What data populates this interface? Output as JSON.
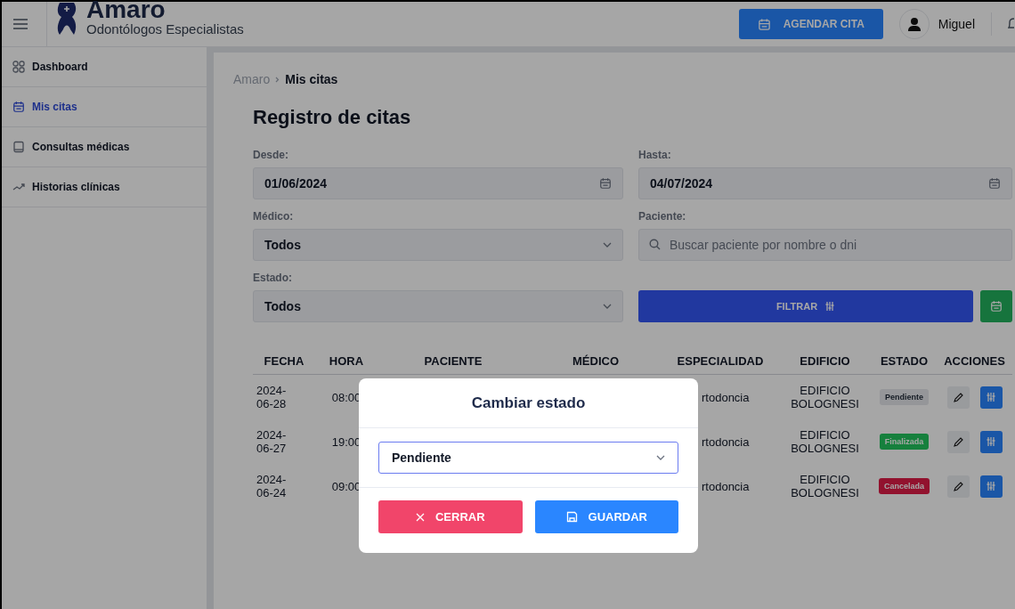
{
  "header": {
    "brand": "Amaro",
    "tagline": "Odontólogos Especialistas",
    "action_button": "AGENDAR CITA",
    "user": "Miguel"
  },
  "sidebar": {
    "items": [
      {
        "label": "Dashboard",
        "selected": false
      },
      {
        "label": "Mis citas",
        "selected": true
      },
      {
        "label": "Consultas médicas",
        "selected": false
      },
      {
        "label": "Historias clínicas",
        "selected": false
      }
    ]
  },
  "breadcrumb": [
    "Amaro",
    "Mis citas"
  ],
  "title": "Registro de citas",
  "filters": [
    {
      "kind": "date",
      "label": "Desde:",
      "value": "01/06/2024"
    },
    {
      "kind": "date",
      "label": "Hasta:",
      "value": "04/07/2024"
    },
    {
      "kind": "select",
      "label": "Médico:",
      "value": "Todos"
    },
    {
      "kind": "search",
      "label": "Paciente:",
      "placeholder": "Buscar paciente por nombre o dni"
    },
    {
      "kind": "select",
      "label": "Estado:",
      "value": "Todos"
    }
  ],
  "filter_button": "FILTRAR",
  "table": {
    "columns": [
      "FECHA",
      "HORA",
      "PACIENTE",
      "MÉDICO",
      "ESPECIALIDAD",
      "EDIFICIO",
      "ESTADO",
      "ACCIONES"
    ],
    "rows": [
      {
        "fecha": "2024-06-28",
        "hora": "08:00",
        "especialidad": "rtodoncia",
        "edificio": "EDIFICIO BOLOGNESI",
        "estado": "Pendiente",
        "kind": "pending"
      },
      {
        "fecha": "2024-06-27",
        "hora": "19:00",
        "especialidad": "rtodoncia",
        "edificio": "EDIFICIO BOLOGNESI",
        "estado": "Finalizada",
        "kind": "done"
      },
      {
        "fecha": "2024-06-24",
        "hora": "09:00",
        "especialidad": "rtodoncia",
        "edificio": "EDIFICIO BOLOGNESI",
        "estado": "Cancelada",
        "kind": "cancelled"
      }
    ]
  },
  "modal": {
    "title": "Cambiar estado",
    "value": "Pendiente",
    "buttons": [
      {
        "kind": "cancel",
        "label": "CERRAR"
      },
      {
        "kind": "save",
        "label": "GUARDAR"
      }
    ]
  }
}
